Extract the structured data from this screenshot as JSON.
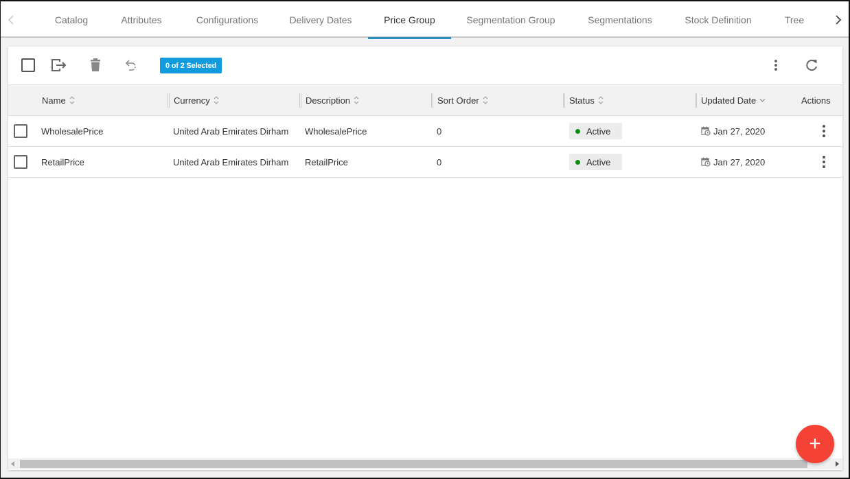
{
  "tabs": {
    "items": [
      {
        "label": "Catalog",
        "active": false
      },
      {
        "label": "Attributes",
        "active": false
      },
      {
        "label": "Configurations",
        "active": false
      },
      {
        "label": "Delivery Dates",
        "active": false
      },
      {
        "label": "Price Group",
        "active": true
      },
      {
        "label": "Segmentation Group",
        "active": false
      },
      {
        "label": "Segmentations",
        "active": false
      },
      {
        "label": "Stock Definition",
        "active": false
      },
      {
        "label": "Tree",
        "active": false
      }
    ],
    "prev_icon": "chevron-left-icon",
    "next_icon": "chevron-right-icon"
  },
  "toolbar": {
    "select_all_icon": "checkbox-icon",
    "export_icon": "export-icon",
    "delete_icon": "trash-icon",
    "undo_icon": "undo-icon",
    "selection_badge": "0 of 2 Selected",
    "more_icon": "more-vert-icon",
    "refresh_icon": "refresh-icon",
    "badge_color": "#139be0"
  },
  "table": {
    "columns": [
      {
        "label": "Name",
        "sort": "none"
      },
      {
        "label": "Currency",
        "sort": "none"
      },
      {
        "label": "Description",
        "sort": "none"
      },
      {
        "label": "Sort Order",
        "sort": "none"
      },
      {
        "label": "Status",
        "sort": "none"
      },
      {
        "label": "Updated Date",
        "sort": "desc"
      },
      {
        "label": "Actions",
        "sort": null
      }
    ],
    "rows": [
      {
        "name": "WholesalePrice",
        "currency": "United Arab Emirates Dirham",
        "description": "WholesalePrice",
        "sort_order": "0",
        "status": "Active",
        "updated_date": "Jan 27, 2020"
      },
      {
        "name": "RetailPrice",
        "currency": "United Arab Emirates Dirham",
        "description": "RetailPrice",
        "sort_order": "0",
        "status": "Active",
        "updated_date": "Jan 27, 2020"
      }
    ],
    "status_color": "#0e8a16"
  },
  "fab": {
    "label": "+",
    "color": "#f44336"
  }
}
